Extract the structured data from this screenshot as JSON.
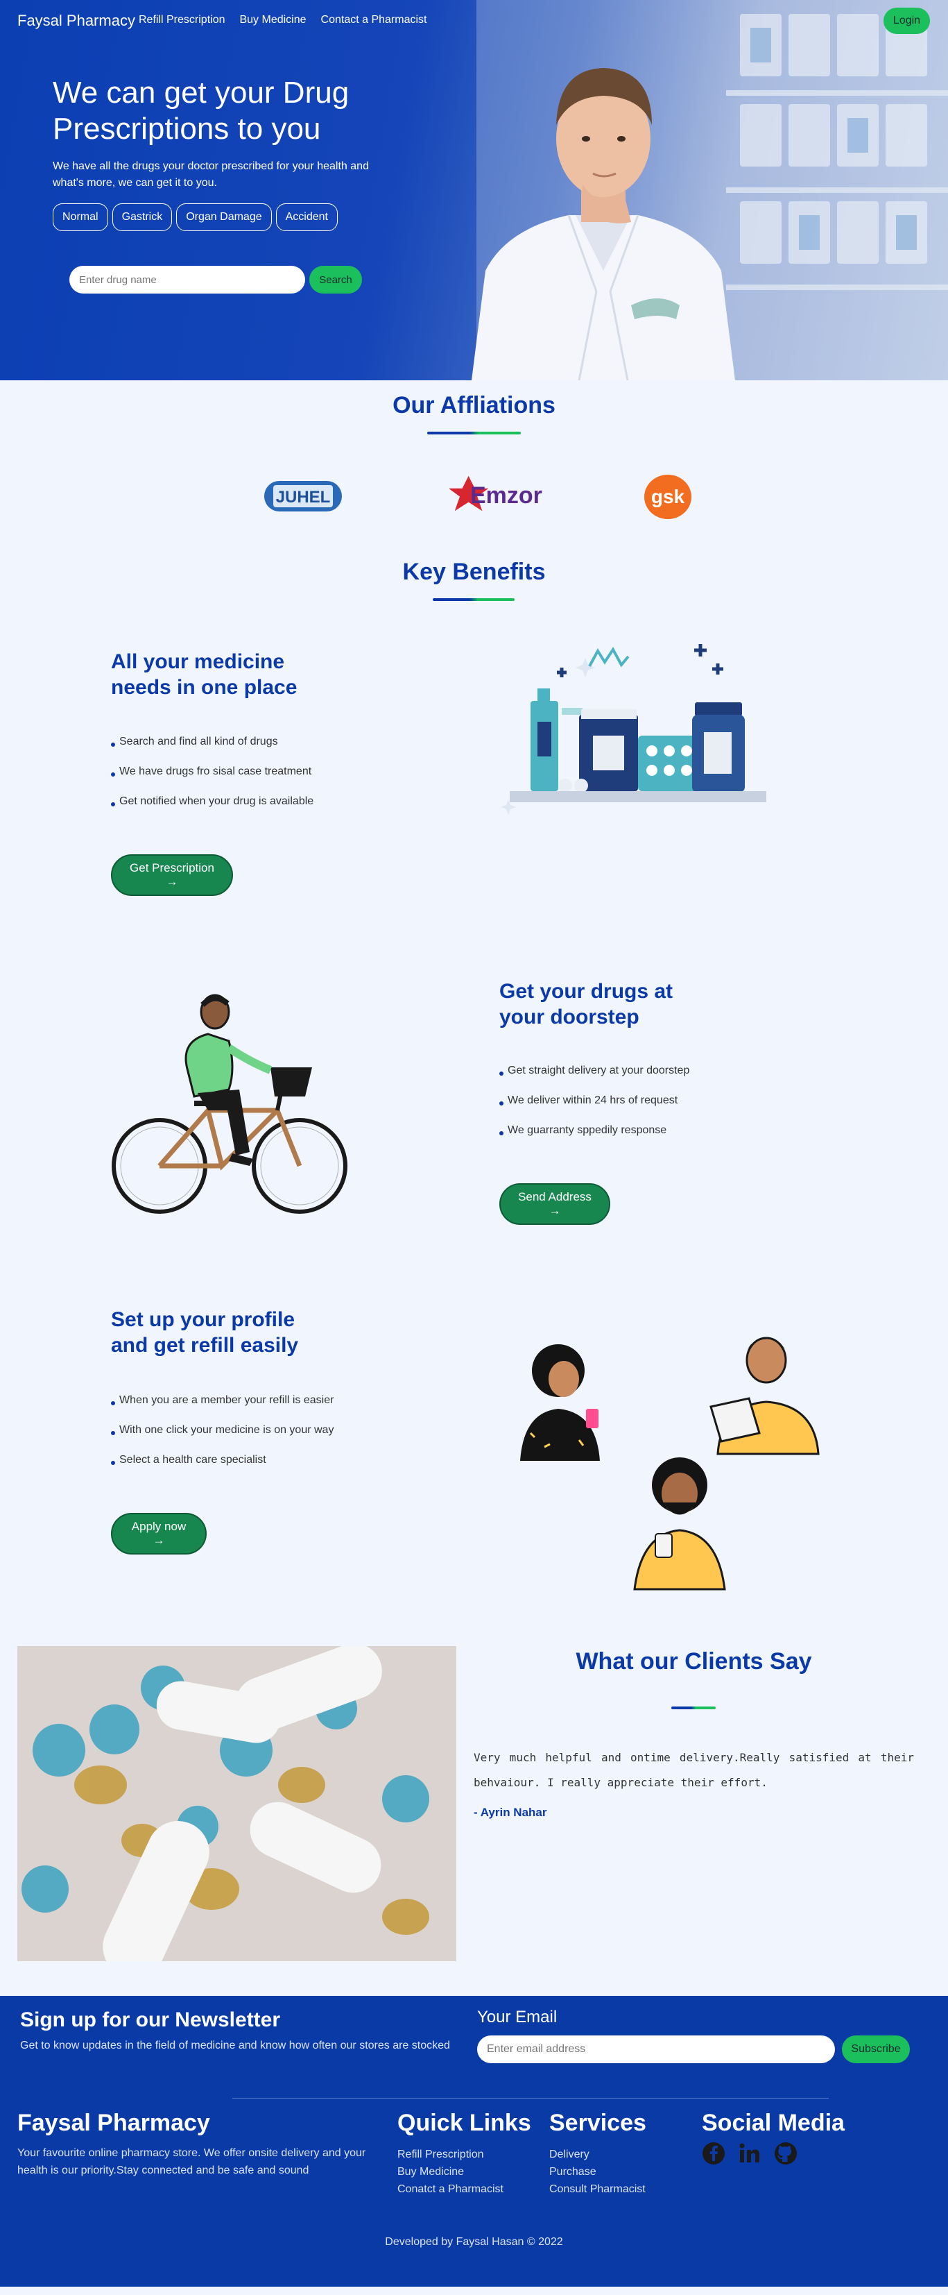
{
  "nav": {
    "brand": "Faysal Pharmacy",
    "links": [
      "Refill Prescription",
      "Buy Medicine",
      "Contact a Pharmacist"
    ],
    "login": "Login"
  },
  "hero": {
    "title": "We can get your Drug Prescriptions to you",
    "subtitle": "We have all the drugs your doctor prescribed for your health and what's more, we can get it to you.",
    "chips": [
      "Normal",
      "Gastrick",
      "Organ Damage",
      "Accident"
    ],
    "search_placeholder": "Enter drug name",
    "search_button": "Search"
  },
  "affiliations": {
    "title": "Our Affliations",
    "logos": [
      "JUHEL",
      "Emzor",
      "gsk"
    ]
  },
  "benefits": {
    "title": "Key Benefits",
    "items": [
      {
        "title": "All your medicine needs in one place",
        "bullets": [
          "Search and find all kind of drugs",
          "We have drugs fro sisal case treatment",
          "Get notified when your drug is available"
        ],
        "button": "Get Prescription →"
      },
      {
        "title": "Get your drugs at your doorstep",
        "bullets": [
          "Get straight delivery at your doorstep",
          "We deliver within 24 hrs of request",
          "We guarranty sppedily response"
        ],
        "button": "Send Address →"
      },
      {
        "title": "Set up your profile and get refill easily",
        "bullets": [
          "When you are a member your refill is easier",
          "With one click your medicine is on your way",
          "Select a health care specialist"
        ],
        "button": "Apply now →"
      }
    ]
  },
  "testimonials": {
    "title": "What our Clients Say",
    "quote": "Very much helpful and ontime delivery.Really satisfied at their behvaiour. I really appreciate their effort.",
    "author": "- Ayrin Nahar"
  },
  "newsletter": {
    "title": "Sign up for our Newsletter",
    "subtitle": "Get to know updates in the field of medicine and know how often our stores are stocked",
    "email_label": "Your Email",
    "email_placeholder": "Enter email address",
    "button": "Subscribe"
  },
  "footer": {
    "brand": "Faysal Pharmacy",
    "about": "Your favourite online pharmacy store. We offer onsite delivery and your health is our priority.Stay connected and be safe and sound",
    "quick_links_title": "Quick Links",
    "quick_links": [
      "Refill Prescription",
      "Buy Medicine",
      "Conatct a Pharmacist"
    ],
    "services_title": "Services",
    "services": [
      "Delivery",
      "Purchase",
      "Consult Pharmacist"
    ],
    "social_title": "Social Media",
    "social_icons": [
      "facebook-icon",
      "linkedin-icon",
      "github-icon"
    ],
    "credit": "Developed by Faysal Hasan © 2022"
  },
  "colors": {
    "primary": "#0b3aa8",
    "accent": "#1bbf5c",
    "cta": "#17874f",
    "background": "#f0f5fe"
  }
}
